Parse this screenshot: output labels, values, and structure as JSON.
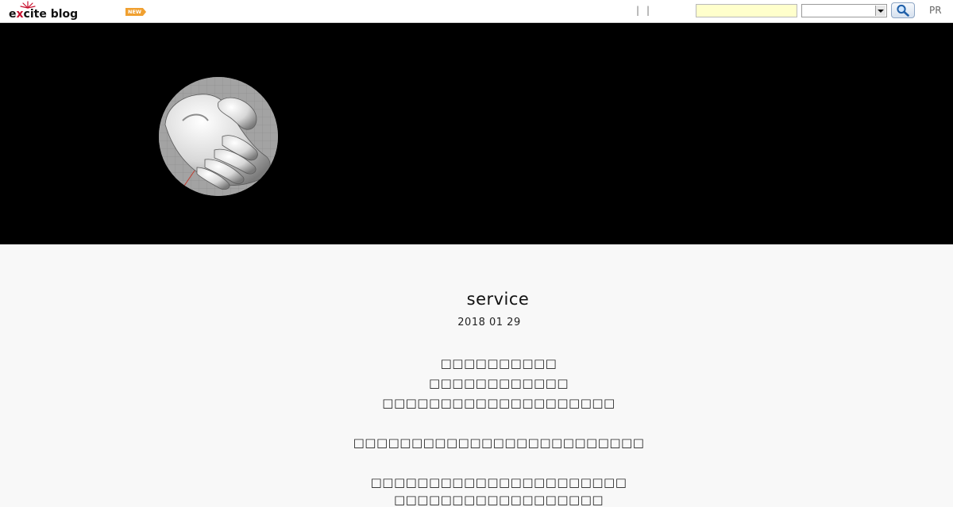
{
  "header": {
    "logo_prefix": "e",
    "logo_x": "x",
    "logo_suffix": "cite blog",
    "new_badge": "NEW",
    "separators": [
      "|",
      "|"
    ],
    "search_placeholder": "",
    "search_select_value": "",
    "pr_label": "PR",
    "colors": {
      "search_bg": "#ffffcc",
      "badge": "#f0a030",
      "logo_accent": "#c8102e"
    }
  },
  "banner": {
    "background": "#000000",
    "avatar_icon": "open-hand-render"
  },
  "post": {
    "title": "service",
    "date": "2018 01 29",
    "lines": [
      "□□□□□□□□□□",
      "□□□□□□□□□□□□",
      "□□□□□□□□□□□□□□□□□□□□",
      "",
      "□□□□□□□□□□□□□□□□□□□□□□□□□",
      "",
      "□□□□□□□□□□□□□□□□□□□□□□",
      "□□□□□□□□□□□□□□□□□□"
    ]
  }
}
